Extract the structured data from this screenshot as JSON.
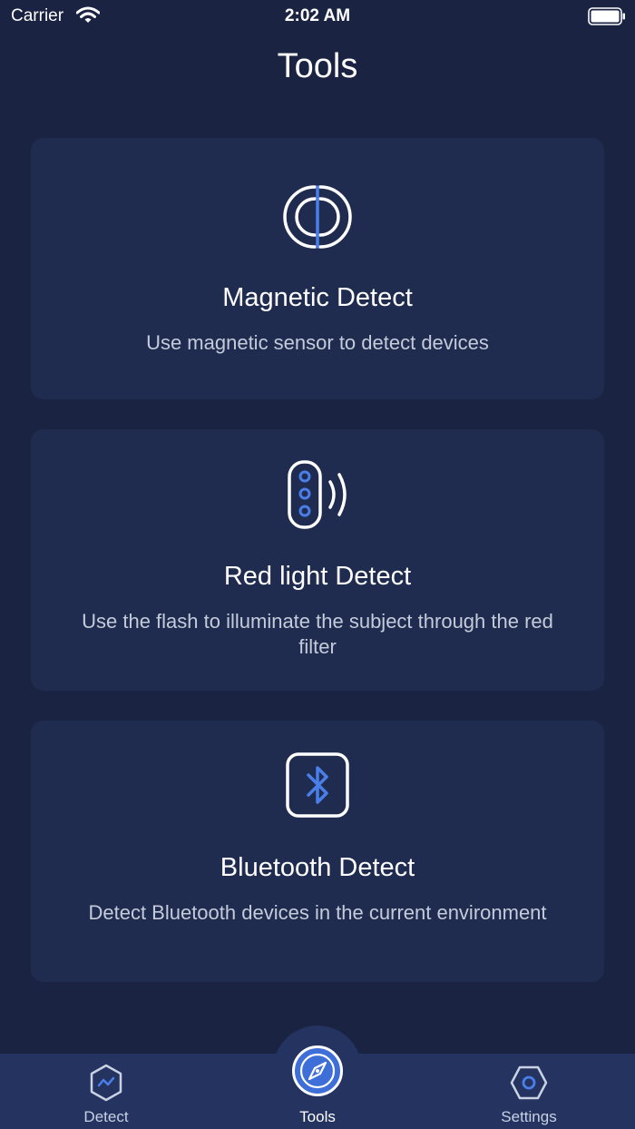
{
  "status_bar": {
    "carrier": "Carrier",
    "time": "2:02 AM",
    "wifi_icon": "wifi-icon",
    "battery_icon": "battery-full-icon"
  },
  "page": {
    "title": "Tools"
  },
  "tools": [
    {
      "icon": "magnetic-icon",
      "title": "Magnetic Detect",
      "description": "Use magnetic sensor to detect devices"
    },
    {
      "icon": "red-light-icon",
      "title": "Red light Detect",
      "description": "Use the flash to illuminate the subject through the red filter"
    },
    {
      "icon": "bluetooth-icon",
      "title": "Bluetooth Detect",
      "description": "Detect Bluetooth devices in the current environment"
    }
  ],
  "tab_bar": {
    "items": [
      {
        "label": "Detect",
        "icon": "detect-hexagon-icon",
        "active": false
      },
      {
        "label": "Tools",
        "icon": "compass-icon",
        "active": true
      },
      {
        "label": "Settings",
        "icon": "settings-hexagon-icon",
        "active": false
      }
    ]
  },
  "colors": {
    "background": "#1a2442",
    "card": "#1f2c50",
    "tab_bar": "#243360",
    "accent": "#4a7ee8",
    "text_secondary": "#c4cbd9"
  }
}
